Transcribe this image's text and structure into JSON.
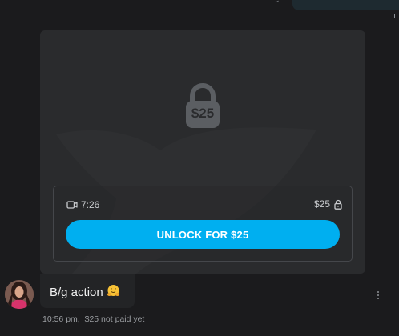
{
  "media": {
    "lock_price": "$25",
    "duration": "7:26",
    "price": "$25",
    "unlock_label": "UNLOCK FOR $25",
    "icons": {
      "lock_large": "padlock-icon",
      "video": "video-camera-icon",
      "lock_small": "padlock-icon"
    }
  },
  "message": {
    "text": "B/g action",
    "emoji": "hugging-face-emoji",
    "time": "10:56 pm,",
    "status": "$25 not paid yet",
    "more_icon": "vertical-ellipsis-icon"
  },
  "colors": {
    "accent": "#00aff0",
    "card_bg": "#2a2b2d",
    "page_bg": "#1b1b1d"
  }
}
